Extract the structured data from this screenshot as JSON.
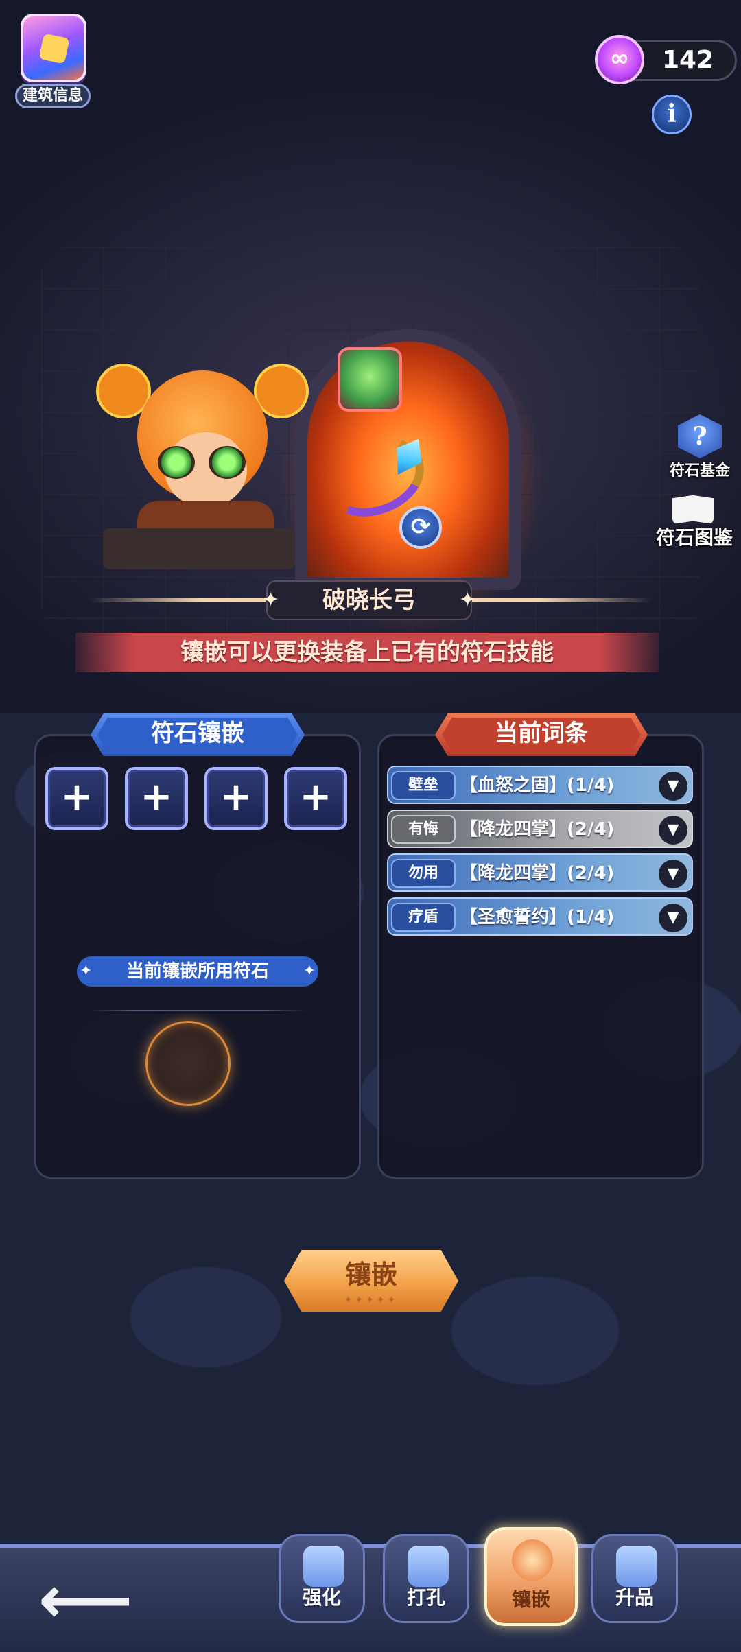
{
  "hud": {
    "building_info_label": "建筑信息",
    "currency_value": "142",
    "currency_icon": "gem-icon",
    "info_label": "i"
  },
  "scene": {
    "equipment_name": "破晓长弓",
    "hint": "镶嵌可以更换装备上已有的符石技能",
    "side_buttons": {
      "rune_fund_label": "符石基金",
      "rune_codex_label": "符石图鉴"
    }
  },
  "left_panel": {
    "title": "符石镶嵌",
    "slots": [
      "+",
      "+",
      "+",
      "+"
    ],
    "used_rune_label": "当前镶嵌所用符石"
  },
  "right_panel": {
    "title": "当前词条",
    "entries": [
      {
        "tag": "壁垒",
        "text": "【血怒之固】(1/4)",
        "style": "blue"
      },
      {
        "tag": "有悔",
        "text": "【降龙四掌】(2/4)",
        "style": "gray"
      },
      {
        "tag": "勿用",
        "text": "【降龙四掌】(2/4)",
        "style": "blue"
      },
      {
        "tag": "疗盾",
        "text": "【圣愈誓约】(1/4)",
        "style": "blue"
      }
    ]
  },
  "inlay_button": {
    "label": "镶嵌",
    "stars": "✦✦✦✦✦"
  },
  "bottom_nav": {
    "back_icon": "arrow-left-icon",
    "tabs": [
      {
        "label": "强化",
        "active": false
      },
      {
        "label": "打孔",
        "active": false
      },
      {
        "label": "镶嵌",
        "active": true
      },
      {
        "label": "升品",
        "active": false
      }
    ]
  },
  "colors": {
    "accent_blue": "#2f5fc8",
    "accent_red": "#c9464b",
    "button_orange": "#f2a24a"
  }
}
